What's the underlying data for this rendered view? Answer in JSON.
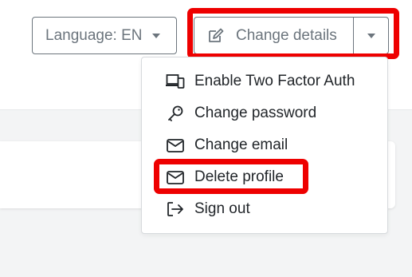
{
  "header": {
    "language_label": "Language: EN",
    "change_details_label": "Change details"
  },
  "menu": {
    "items": [
      {
        "label": "Enable Two Factor Auth",
        "icon": "devices-icon"
      },
      {
        "label": "Change password",
        "icon": "key-icon"
      },
      {
        "label": "Change email",
        "icon": "envelope-icon"
      },
      {
        "label": "Delete profile",
        "icon": "envelope-icon"
      },
      {
        "label": "Sign out",
        "icon": "sign-out-icon"
      }
    ]
  },
  "colors": {
    "highlight": "#ee0000",
    "button_border": "#6c757d",
    "page_background": "#f3f4f5"
  }
}
